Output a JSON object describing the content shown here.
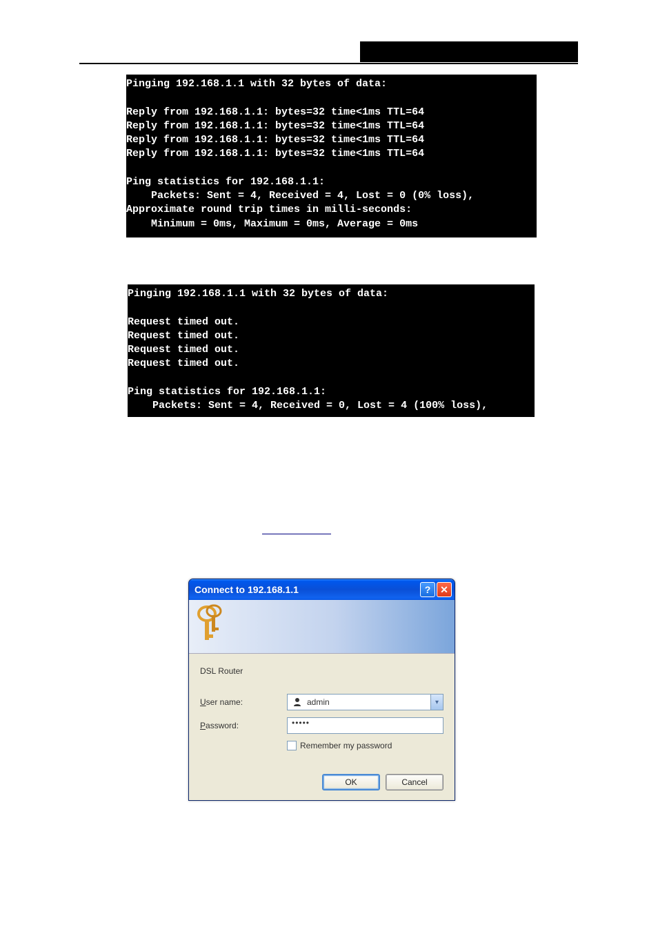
{
  "terminal_success": "Pinging 192.168.1.1 with 32 bytes of data:\n\nReply from 192.168.1.1: bytes=32 time<1ms TTL=64\nReply from 192.168.1.1: bytes=32 time<1ms TTL=64\nReply from 192.168.1.1: bytes=32 time<1ms TTL=64\nReply from 192.168.1.1: bytes=32 time<1ms TTL=64\n\nPing statistics for 192.168.1.1:\n    Packets: Sent = 4, Received = 4, Lost = 0 (0% loss),\nApproximate round trip times in milli-seconds:\n    Minimum = 0ms, Maximum = 0ms, Average = 0ms",
  "terminal_fail": "Pinging 192.168.1.1 with 32 bytes of data:\n\nRequest timed out.\nRequest timed out.\nRequest timed out.\nRequest timed out.\n\nPing statistics for 192.168.1.1:\n    Packets: Sent = 4, Received = 0, Lost = 4 (100% loss),",
  "dialog": {
    "title": "Connect to 192.168.1.1",
    "realm": "DSL Router",
    "username_label_pre": "U",
    "username_label_post": "ser name:",
    "username_value": "admin",
    "password_label_pre": "P",
    "password_label_post": "assword:",
    "password_value": "•••••",
    "remember_pre": "R",
    "remember_post": "emember my password",
    "ok": "OK",
    "cancel": "Cancel"
  }
}
